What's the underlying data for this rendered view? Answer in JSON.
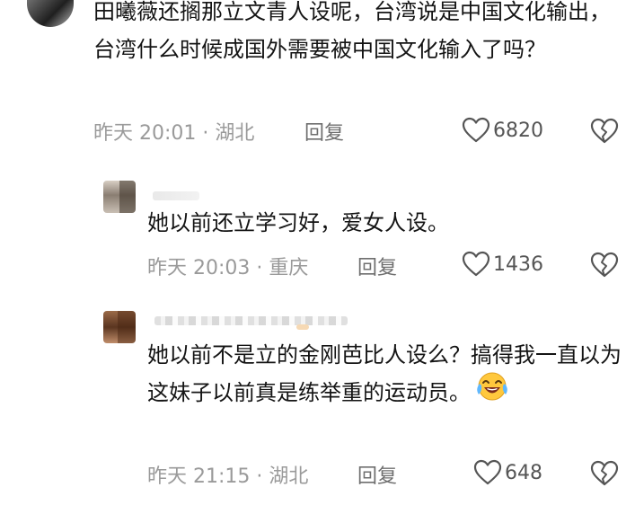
{
  "main_comment": {
    "text": "田曦薇还搁那立文青人设呢，台湾说是中国文化输出，台湾什么时候成国外需要被中国文化输入了吗？",
    "time": "昨天 20:01",
    "separator": "·",
    "location": "湖北",
    "reply_label": "回复",
    "likes": "6820",
    "like_icon": "heart-outline-icon",
    "dislike_icon": "broken-heart-icon"
  },
  "replies": [
    {
      "text": "她以前还立学习好，爱女人设。",
      "time": "昨天 20:03",
      "separator": "·",
      "location": "重庆",
      "reply_label": "回复",
      "likes": "1436"
    },
    {
      "text": "她以前不是立的金刚芭比人设么？搞得我一直以为这妹子以前真是练举重的运动员。",
      "emoji": "laughing-crying-emoji",
      "time": "昨天 21:15",
      "separator": "·",
      "location": "湖北",
      "reply_label": "回复",
      "likes": "648"
    }
  ],
  "colors": {
    "text": "#141414",
    "meta": "#9a9a9a",
    "icon": "#555555",
    "emoji_face": "#ffc83d"
  }
}
